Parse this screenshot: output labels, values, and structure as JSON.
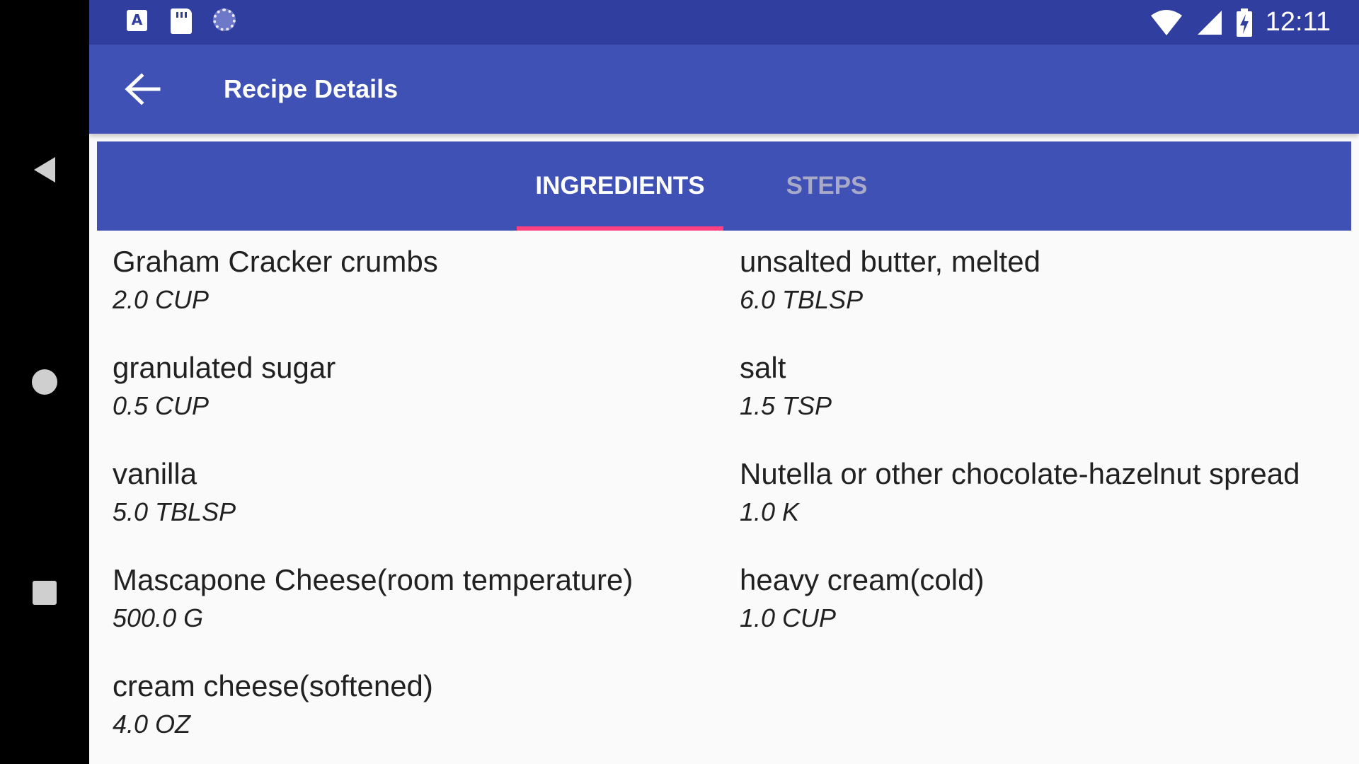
{
  "status_bar": {
    "time": "12:11",
    "a_icon_letter": "A"
  },
  "toolbar": {
    "title": "Recipe Details"
  },
  "tabs": [
    {
      "label": "INGREDIENTS",
      "selected": true
    },
    {
      "label": "STEPS",
      "selected": false
    }
  ],
  "ingredients": [
    {
      "name": "Graham Cracker crumbs",
      "quantity": "2.0 CUP"
    },
    {
      "name": "unsalted butter, melted",
      "quantity": "6.0 TBLSP"
    },
    {
      "name": "granulated sugar",
      "quantity": "0.5 CUP"
    },
    {
      "name": "salt",
      "quantity": "1.5 TSP"
    },
    {
      "name": "vanilla",
      "quantity": "5.0 TBLSP"
    },
    {
      "name": "Nutella or other chocolate-hazelnut spread",
      "quantity": "1.0 K"
    },
    {
      "name": "Mascapone Cheese(room temperature)",
      "quantity": "500.0 G"
    },
    {
      "name": "heavy cream(cold)",
      "quantity": "1.0 CUP"
    },
    {
      "name": "cream cheese(softened)",
      "quantity": "4.0 OZ"
    }
  ],
  "colors": {
    "primary": "#3f51b5",
    "primary_dark": "#303f9f",
    "accent": "#ff4081"
  }
}
